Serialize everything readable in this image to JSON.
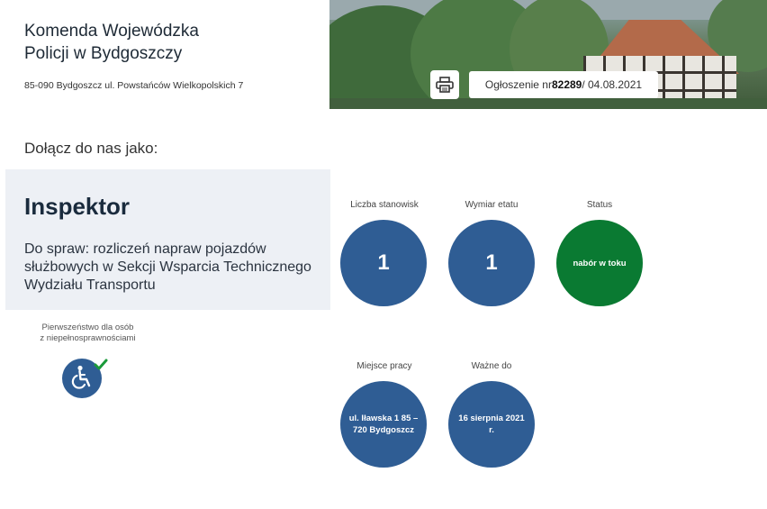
{
  "institution": {
    "name_line1": "Komenda Wojewódzka",
    "name_line2": "Policji w Bydgoszczy",
    "address": "85-090 Bydgoszcz ul. Powstańców Wielkopolskich 7"
  },
  "announcement": {
    "prefix": "Ogłoszenie nr ",
    "number": "82289",
    "date": " / 04.08.2021"
  },
  "join_label": "Dołącz do nas jako:",
  "job": {
    "title": "Inspektor",
    "description": "Do spraw: rozliczeń napraw pojazdów służbowych w Sekcji Wsparcia Technicznego Wydziału Transportu"
  },
  "priority": {
    "line1": "Pierwszeństwo dla osób",
    "line2": "z niepełnosprawnościami"
  },
  "stats": {
    "positions": {
      "label": "Liczba stanowisk",
      "value": "1"
    },
    "fte": {
      "label": "Wymiar etatu",
      "value": "1"
    },
    "status": {
      "label": "Status",
      "value": "nabór w toku"
    },
    "workplace": {
      "label": "Miejsce pracy",
      "value": "ul. Iławska 1 85 – 720 Bydgoszcz"
    },
    "valid_until": {
      "label": "Ważne do",
      "value": "16 sierpnia 2021 r."
    }
  },
  "colors": {
    "circle_blue": "#2f5d94",
    "circle_green": "#0a7a32",
    "card_bg": "#edf0f5",
    "check_green": "#1a9a3a"
  },
  "icons": {
    "print": "printer-icon",
    "accessibility": "wheelchair-icon",
    "check": "check-icon"
  }
}
